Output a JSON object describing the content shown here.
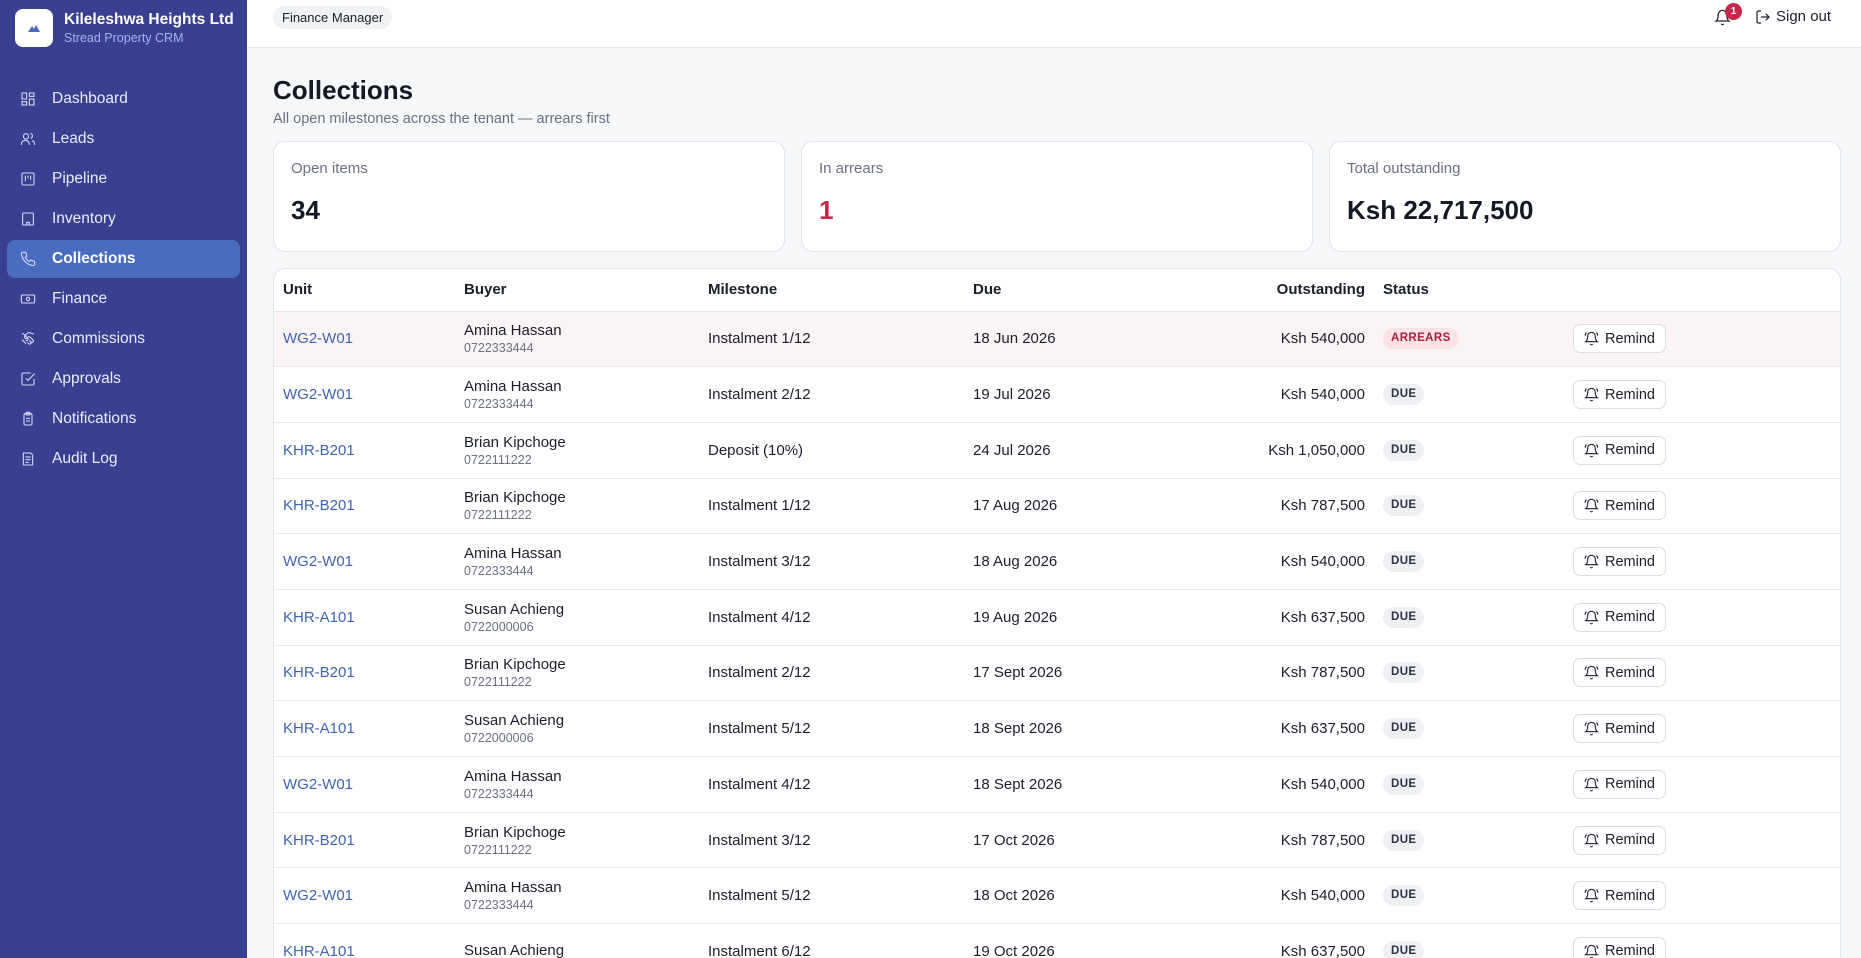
{
  "brand": {
    "name": "Kileleshwa Heights Ltd",
    "subtitle": "Stread Property CRM",
    "logo_icon": "mountain-logo-icon"
  },
  "sidebar": {
    "items": [
      {
        "label": "Dashboard",
        "icon": "grid-icon",
        "active": false
      },
      {
        "label": "Leads",
        "icon": "users-icon",
        "active": false
      },
      {
        "label": "Pipeline",
        "icon": "kanban-icon",
        "active": false
      },
      {
        "label": "Inventory",
        "icon": "building-icon",
        "active": false
      },
      {
        "label": "Collections",
        "icon": "phone-icon",
        "active": true
      },
      {
        "label": "Finance",
        "icon": "banknote-icon",
        "active": false
      },
      {
        "label": "Commissions",
        "icon": "handshake-icon",
        "active": false
      },
      {
        "label": "Approvals",
        "icon": "check-square-icon",
        "active": false
      },
      {
        "label": "Notifications",
        "icon": "clipboard-icon",
        "active": false
      },
      {
        "label": "Audit Log",
        "icon": "log-icon",
        "active": false
      }
    ]
  },
  "topbar": {
    "role": "Finance Manager",
    "notification_count": "1",
    "signout_label": "Sign out"
  },
  "page": {
    "title": "Collections",
    "subtitle": "All open milestones across the tenant — arrears first"
  },
  "stats": {
    "open_items": {
      "label": "Open items",
      "value": "34"
    },
    "in_arrears": {
      "label": "In arrears",
      "value": "1"
    },
    "total_outstanding": {
      "label": "Total outstanding",
      "value": "Ksh 22,717,500"
    }
  },
  "table": {
    "headers": {
      "unit": "Unit",
      "buyer": "Buyer",
      "milestone": "Milestone",
      "due": "Due",
      "outstanding": "Outstanding",
      "status": "Status"
    },
    "action_label": "Remind",
    "rows": [
      {
        "unit": "WG2-W01",
        "buyer": "Amina Hassan",
        "phone": "0722333444",
        "milestone": "Instalment 1/12",
        "due": "18 Jun 2026",
        "outstanding": "Ksh 540,000",
        "status": "ARREARS"
      },
      {
        "unit": "WG2-W01",
        "buyer": "Amina Hassan",
        "phone": "0722333444",
        "milestone": "Instalment 2/12",
        "due": "19 Jul 2026",
        "outstanding": "Ksh 540,000",
        "status": "DUE"
      },
      {
        "unit": "KHR-B201",
        "buyer": "Brian Kipchoge",
        "phone": "0722111222",
        "milestone": "Deposit (10%)",
        "due": "24 Jul 2026",
        "outstanding": "Ksh 1,050,000",
        "status": "DUE"
      },
      {
        "unit": "KHR-B201",
        "buyer": "Brian Kipchoge",
        "phone": "0722111222",
        "milestone": "Instalment 1/12",
        "due": "17 Aug 2026",
        "outstanding": "Ksh 787,500",
        "status": "DUE"
      },
      {
        "unit": "WG2-W01",
        "buyer": "Amina Hassan",
        "phone": "0722333444",
        "milestone": "Instalment 3/12",
        "due": "18 Aug 2026",
        "outstanding": "Ksh 540,000",
        "status": "DUE"
      },
      {
        "unit": "KHR-A101",
        "buyer": "Susan Achieng",
        "phone": "0722000006",
        "milestone": "Instalment 4/12",
        "due": "19 Aug 2026",
        "outstanding": "Ksh 637,500",
        "status": "DUE"
      },
      {
        "unit": "KHR-B201",
        "buyer": "Brian Kipchoge",
        "phone": "0722111222",
        "milestone": "Instalment 2/12",
        "due": "17 Sept 2026",
        "outstanding": "Ksh 787,500",
        "status": "DUE"
      },
      {
        "unit": "KHR-A101",
        "buyer": "Susan Achieng",
        "phone": "0722000006",
        "milestone": "Instalment 5/12",
        "due": "18 Sept 2026",
        "outstanding": "Ksh 637,500",
        "status": "DUE"
      },
      {
        "unit": "WG2-W01",
        "buyer": "Amina Hassan",
        "phone": "0722333444",
        "milestone": "Instalment 4/12",
        "due": "18 Sept 2026",
        "outstanding": "Ksh 540,000",
        "status": "DUE"
      },
      {
        "unit": "KHR-B201",
        "buyer": "Brian Kipchoge",
        "phone": "0722111222",
        "milestone": "Instalment 3/12",
        "due": "17 Oct 2026",
        "outstanding": "Ksh 787,500",
        "status": "DUE"
      },
      {
        "unit": "WG2-W01",
        "buyer": "Amina Hassan",
        "phone": "0722333444",
        "milestone": "Instalment 5/12",
        "due": "18 Oct 2026",
        "outstanding": "Ksh 540,000",
        "status": "DUE"
      },
      {
        "unit": "KHR-A101",
        "buyer": "Susan Achieng",
        "phone": "",
        "milestone": "Instalment 6/12",
        "due": "19 Oct 2026",
        "outstanding": "Ksh 637,500",
        "status": "DUE"
      }
    ]
  },
  "colors": {
    "sidebar": "#3b3f8f",
    "active_nav": "#4a6cbf",
    "link": "#3d64b5",
    "danger": "#c8264b"
  }
}
